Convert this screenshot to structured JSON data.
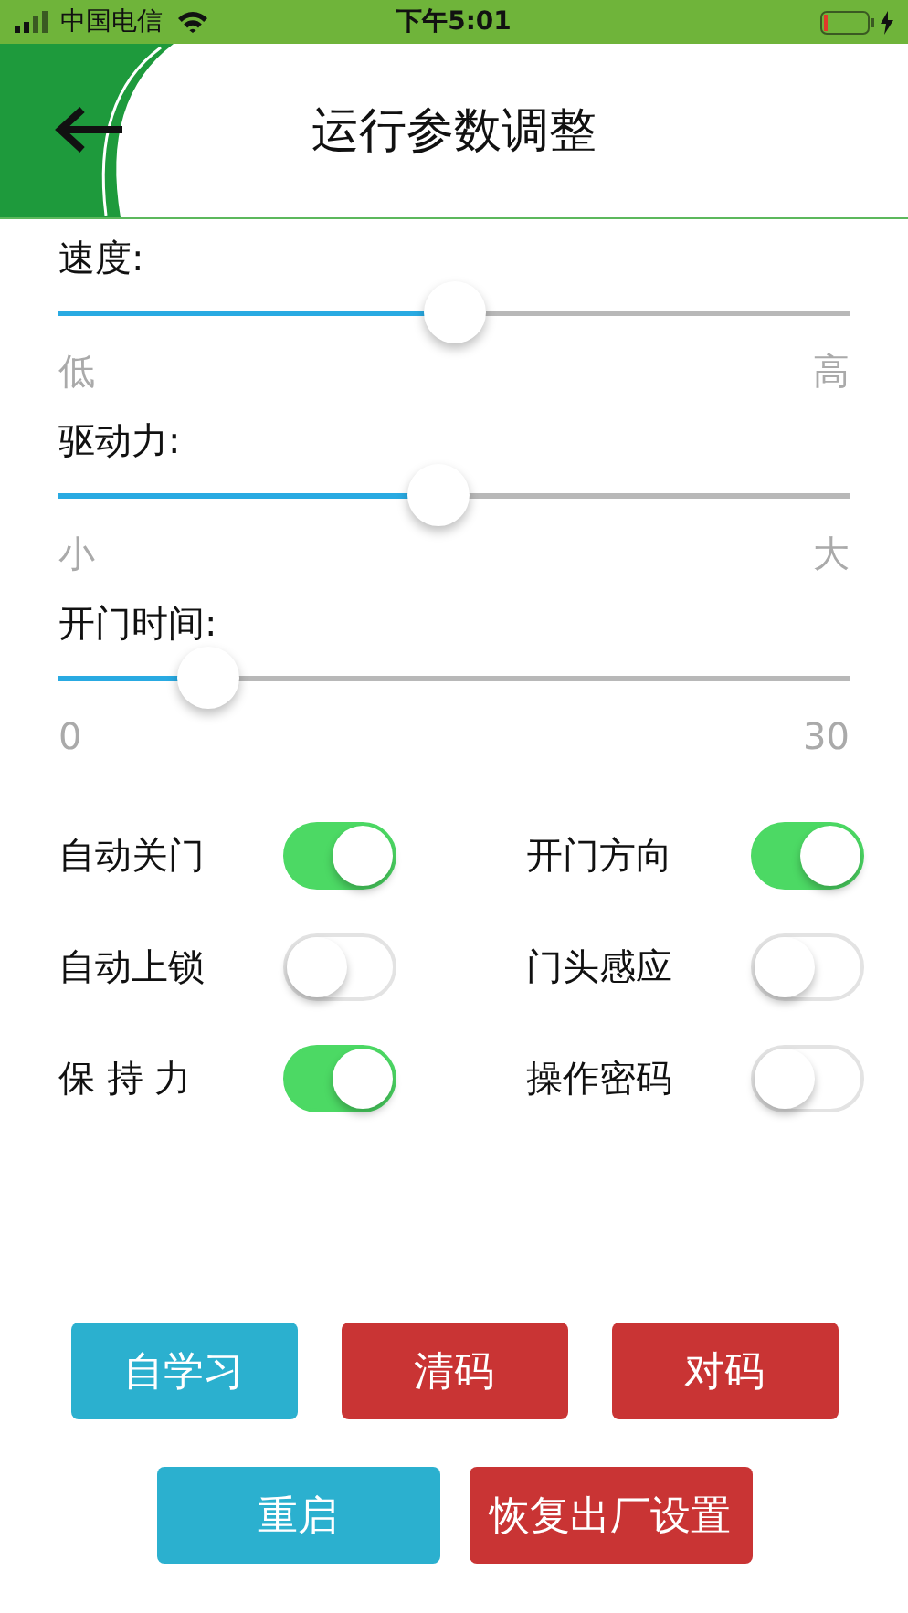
{
  "status_bar": {
    "carrier": "中国电信",
    "time": "下午5:01"
  },
  "header": {
    "title": "运行参数调整"
  },
  "sliders": [
    {
      "label": "速度:",
      "level": 0.5,
      "min_label": "低",
      "max_label": "高"
    },
    {
      "label": "驱动力:",
      "level": 0.48,
      "min_label": "小",
      "max_label": "大"
    },
    {
      "label": "开门时间:",
      "level": 0.19,
      "min_label": "0",
      "max_label": "30"
    }
  ],
  "toggles": [
    {
      "label": "自动关门",
      "on": true
    },
    {
      "label": "开门方向",
      "on": true
    },
    {
      "label": "自动上锁",
      "on": false
    },
    {
      "label": "门头感应",
      "on": false
    },
    {
      "label": "保 持 力",
      "on": true
    },
    {
      "label": "操作密码",
      "on": false
    }
  ],
  "button_rows": [
    {
      "buttons": [
        {
          "label": "自学习",
          "color": "#2bb0cf"
        },
        {
          "label": "清码",
          "color": "#c93434"
        },
        {
          "label": "对码",
          "color": "#c93434"
        }
      ]
    },
    {
      "buttons": [
        {
          "label": "重启",
          "color": "#2bb0cf"
        },
        {
          "label": "恢复出厂设置",
          "color": "#c93434"
        }
      ]
    }
  ]
}
